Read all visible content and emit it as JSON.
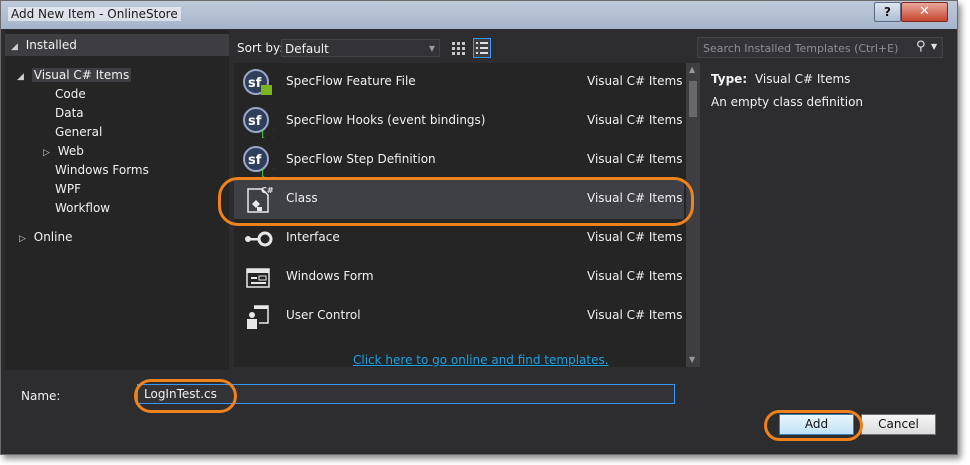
{
  "window": {
    "title": "Add New Item - OnlineStore",
    "help_label": "?",
    "close_label": "✕"
  },
  "tree": {
    "installed": "Installed",
    "root": "Visual C# Items",
    "children": [
      "Code",
      "Data",
      "General",
      "Web",
      "Windows Forms",
      "WPF",
      "Workflow"
    ],
    "online": "Online"
  },
  "sort": {
    "label": "Sort by:",
    "value": "Default"
  },
  "templates": [
    {
      "name": "SpecFlow Feature File",
      "category": "Visual C# Items",
      "icon": "specflow-feature-icon"
    },
    {
      "name": "SpecFlow Hooks (event bindings)",
      "category": "Visual C# Items",
      "icon": "specflow-hooks-icon"
    },
    {
      "name": "SpecFlow Step Definition",
      "category": "Visual C# Items",
      "icon": "specflow-step-icon"
    },
    {
      "name": "Class",
      "category": "Visual C# Items",
      "icon": "csharp-class-icon"
    },
    {
      "name": "Interface",
      "category": "Visual C# Items",
      "icon": "interface-icon"
    },
    {
      "name": "Windows Form",
      "category": "Visual C# Items",
      "icon": "windows-form-icon"
    },
    {
      "name": "User Control",
      "category": "Visual C# Items",
      "icon": "user-control-icon"
    }
  ],
  "online_link": "Click here to go online and find templates.",
  "search": {
    "placeholder": "Search Installed Templates (Ctrl+E)"
  },
  "description": {
    "type_label": "Type:",
    "type_value": "Visual C# Items",
    "text": "An empty class definition"
  },
  "name_field": {
    "label": "Name:",
    "value": "LogInTest.cs"
  },
  "buttons": {
    "add": "Add",
    "cancel": "Cancel"
  },
  "colors": {
    "highlight_ring": "#f0821e",
    "link": "#1ba1e2",
    "background": "#2d2d30"
  }
}
